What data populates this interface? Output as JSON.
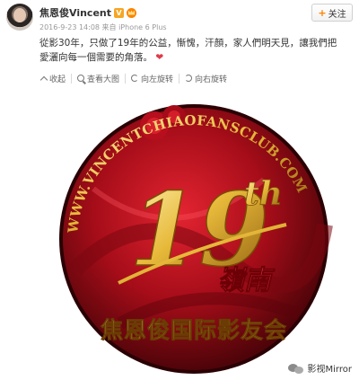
{
  "user": {
    "name": "焦恩俊Vincent",
    "verified_badge": "V"
  },
  "follow": {
    "label": "关注"
  },
  "meta": {
    "timestamp": "2016-9-23 14:08",
    "source": "来自 iPhone 6 Plus"
  },
  "post": {
    "text": "從影30年，只做了19年的公益，慚愧，汗顏，家人們明天見，讓我們把愛灑向每一個需要的角落。",
    "emoji": "❤"
  },
  "toolbar": {
    "collapse": "收起",
    "view_large": "查看大图",
    "rotate_left": "向左旋转",
    "rotate_right": "向右旋转"
  },
  "image": {
    "website": "WWW.VINCENTCHIAOFANSCLUB.COM",
    "number": "19",
    "suffix": "th",
    "region": "嶺南",
    "club_name": "焦恩俊国际影友会"
  },
  "watermark": {
    "text": "影视Mirror"
  },
  "colors": {
    "accent": "#ff8200",
    "heart": "#e03a4a",
    "logo_red": "#b0101e",
    "logo_gold": "#e7b93a"
  }
}
